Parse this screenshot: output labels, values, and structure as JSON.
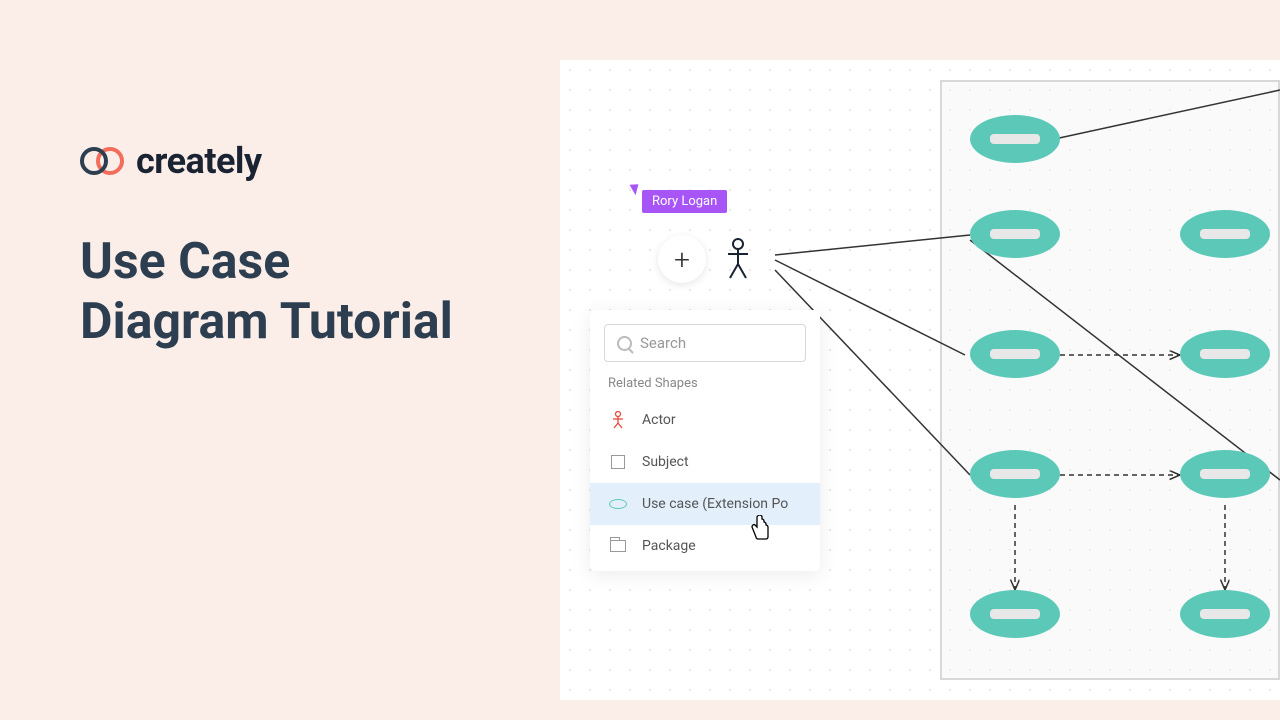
{
  "brand": {
    "name": "creately"
  },
  "heading": {
    "line1": "Use Case",
    "line2": "Diagram Tutorial"
  },
  "canvas": {
    "user_tag": "Rory Logan",
    "add_button": "+",
    "panel": {
      "search_placeholder": "Search",
      "section_title": "Related Shapes",
      "items": [
        {
          "label": "Actor",
          "icon": "actor"
        },
        {
          "label": "Subject",
          "icon": "subject"
        },
        {
          "label": "Use case (Extension Po",
          "icon": "usecase",
          "selected": true
        },
        {
          "label": "Package",
          "icon": "package"
        }
      ]
    }
  }
}
